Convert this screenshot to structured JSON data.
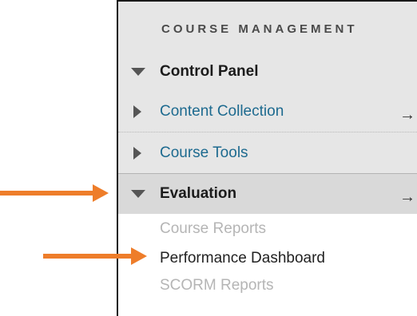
{
  "menu": {
    "heading": "COURSE MANAGEMENT",
    "items": [
      {
        "label": "Control Panel",
        "icon": "triangle-down-icon"
      },
      {
        "label": "Content Collection",
        "icon": "triangle-right-icon",
        "go": "→"
      },
      {
        "label": "Course Tools",
        "icon": "triangle-right-icon"
      },
      {
        "label": "Evaluation",
        "icon": "triangle-down-icon",
        "go": "→"
      }
    ],
    "evaluation_subitems": [
      {
        "label": "Course Reports"
      },
      {
        "label": "Performance Dashboard"
      },
      {
        "label": "SCORM Reports"
      }
    ]
  },
  "colors": {
    "accent_arrow": "#ee7d2a",
    "link": "#1d6a8f",
    "header_bg": "#e6e6e6",
    "expanded_bg": "#d9d9d9"
  }
}
